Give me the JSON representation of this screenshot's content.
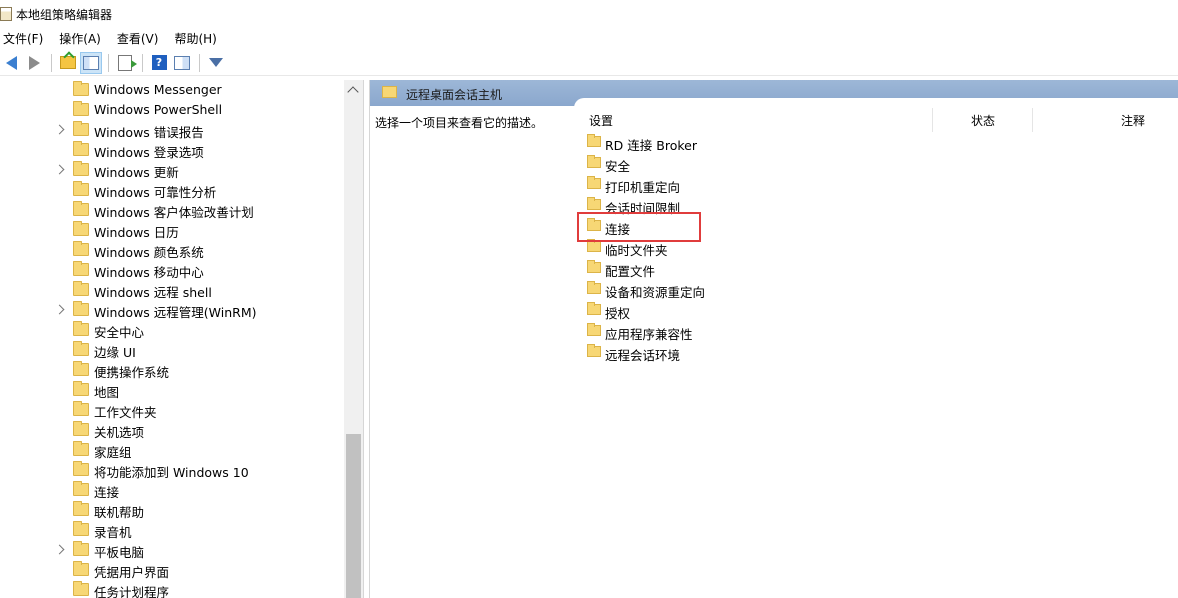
{
  "window": {
    "title": "本地组策略编辑器"
  },
  "menu": [
    {
      "label": "文件(F)"
    },
    {
      "label": "操作(A)"
    },
    {
      "label": "查看(V)"
    },
    {
      "label": "帮助(H)"
    }
  ],
  "toolbar": {
    "icons": [
      "back-arrow-icon",
      "forward-arrow-icon",
      "folder-up-icon",
      "show-hide-tree-icon",
      "export-list-icon",
      "help-icon",
      "properties-icon",
      "filter-icon"
    ]
  },
  "tree": {
    "items": [
      {
        "label": "Windows Messenger",
        "expandable": false
      },
      {
        "label": "Windows PowerShell",
        "expandable": false
      },
      {
        "label": "Windows 错误报告",
        "expandable": true
      },
      {
        "label": "Windows 登录选项",
        "expandable": false
      },
      {
        "label": "Windows 更新",
        "expandable": true
      },
      {
        "label": "Windows 可靠性分析",
        "expandable": false
      },
      {
        "label": "Windows 客户体验改善计划",
        "expandable": false
      },
      {
        "label": "Windows 日历",
        "expandable": false
      },
      {
        "label": "Windows 颜色系统",
        "expandable": false
      },
      {
        "label": "Windows 移动中心",
        "expandable": false
      },
      {
        "label": "Windows 远程 shell",
        "expandable": false
      },
      {
        "label": "Windows 远程管理(WinRM)",
        "expandable": true
      },
      {
        "label": "安全中心",
        "expandable": false
      },
      {
        "label": "边缘 UI",
        "expandable": false
      },
      {
        "label": "便携操作系统",
        "expandable": false
      },
      {
        "label": "地图",
        "expandable": false
      },
      {
        "label": "工作文件夹",
        "expandable": false
      },
      {
        "label": "关机选项",
        "expandable": false
      },
      {
        "label": "家庭组",
        "expandable": false
      },
      {
        "label": "将功能添加到 Windows 10",
        "expandable": false
      },
      {
        "label": "连接",
        "expandable": false
      },
      {
        "label": "联机帮助",
        "expandable": false
      },
      {
        "label": "录音机",
        "expandable": false
      },
      {
        "label": "平板电脑",
        "expandable": true
      },
      {
        "label": "凭据用户界面",
        "expandable": false
      },
      {
        "label": "任务计划程序",
        "expandable": false
      }
    ]
  },
  "details": {
    "header_title": "远程桌面会话主机",
    "description_hint": "选择一个项目来查看它的描述。",
    "columns": {
      "setting": "设置",
      "state": "状态",
      "comment": "注释"
    },
    "settings": [
      {
        "label": "RD 连接 Broker"
      },
      {
        "label": "安全"
      },
      {
        "label": "打印机重定向"
      },
      {
        "label": "会话时间限制"
      },
      {
        "label": "连接",
        "highlighted": true
      },
      {
        "label": "临时文件夹"
      },
      {
        "label": "配置文件"
      },
      {
        "label": "设备和资源重定向"
      },
      {
        "label": "授权"
      },
      {
        "label": "应用程序兼容性"
      },
      {
        "label": "远程会话环境"
      }
    ],
    "highlight_color": "#e03c3c"
  }
}
